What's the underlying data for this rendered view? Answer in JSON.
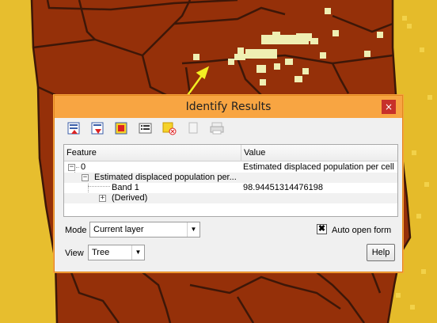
{
  "dialog": {
    "title": "Identify Results",
    "close_glyph": "×"
  },
  "toolbar": {
    "icons": [
      "expand-tree-icon",
      "collapse-tree-icon",
      "expand-new-results-icon",
      "clear-results-icon",
      "highlight-icon",
      "copy-icon",
      "print-icon"
    ]
  },
  "results": {
    "columns": [
      "Feature",
      "Value"
    ],
    "rows": [
      {
        "feature": "0",
        "value": "Estimated displaced population per cell",
        "expander": "−"
      },
      {
        "feature": "Estimated displaced population per...",
        "value": "",
        "expander": "−"
      },
      {
        "feature": "Band 1",
        "value": "98.94451314476198",
        "expander": ""
      },
      {
        "feature": "(Derived)",
        "value": "",
        "expander": "+"
      }
    ]
  },
  "mode": {
    "label": "Mode",
    "value": "Current layer"
  },
  "view": {
    "label": "View",
    "value": "Tree"
  },
  "auto_open": {
    "label": "Auto open form",
    "checked": true,
    "check_glyph": "✖"
  },
  "help": {
    "label": "Help"
  },
  "colors": {
    "map_fill": "#953009",
    "map_lines": "#3d1708",
    "map_border": "#e5bd2c",
    "highlight_cells": "#efefb3",
    "arrow": "#f3ee23",
    "dialog_border": "#f8a542"
  }
}
